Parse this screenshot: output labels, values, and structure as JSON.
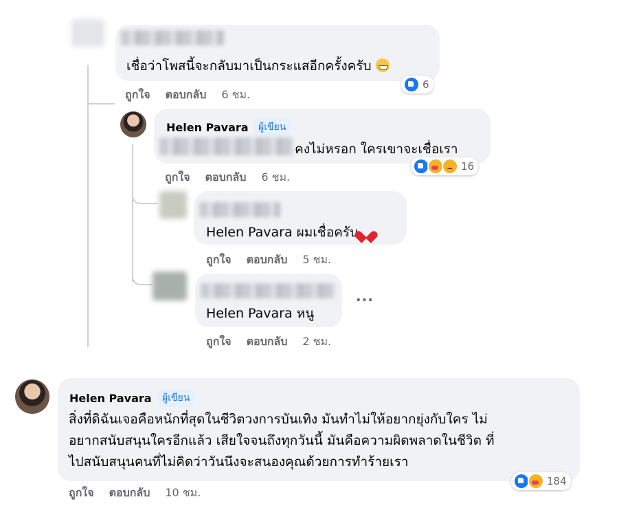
{
  "thread": {
    "c1": {
      "text": "เชื่อว่าโพสนี้จะกลับมาเป็นกระแสอีกครั้งครับ",
      "reactions": {
        "icons": [
          "like-icon"
        ],
        "count": "6"
      },
      "actions": {
        "like": "ถูกใจ",
        "reply": "ตอบกลับ",
        "time": "6 ชม."
      }
    },
    "r1": {
      "author": "Helen Pavara",
      "badge": "ผู้เขียน",
      "text": "คงไม่หรอก ใครเขาจะเชื่อเรา",
      "reactions": {
        "icons": [
          "like-icon",
          "care-icon",
          "sad-icon"
        ],
        "count": "16"
      },
      "actions": {
        "like": "ถูกใจ",
        "reply": "ตอบกลับ",
        "time": "6 ชม."
      }
    },
    "r2": {
      "text": "Helen Pavara ผมเชื่อครับ",
      "actions": {
        "like": "ถูกใจ",
        "reply": "ตอบกลับ",
        "time": "5 ชม."
      }
    },
    "r3": {
      "text": "Helen Pavara หนู",
      "more": "···",
      "actions": {
        "like": "ถูกใจ",
        "reply": "ตอบกลับ",
        "time": "2 ชม."
      }
    }
  },
  "c2": {
    "author": "Helen Pavara",
    "badge": "ผู้เขียน",
    "text": "สิ่งที่ดิฉันเจอคือหนักที่สุดในชีวิตวงการบันเทิง มันทำไม่ให้อยากยุ่งกับใคร ไม่\nอยากสนับสนุนใครอีกแล้ว เสียใจจนถึงทุกวันนี้ มันคือความผิดพลาดในชีวิต ที่\nไปสนับสนุนคนที่ไม่คิดว่าวันนึงจะสนองคุณด้วยการทำร้ายเรา",
    "reactions": {
      "icons": [
        "like-icon",
        "care-icon"
      ],
      "count": "184"
    },
    "actions": {
      "like": "ถูกใจ",
      "reply": "ตอบกลับ",
      "time": "10 ชม."
    }
  },
  "colors": {
    "bubble": "#f0f2f5",
    "secondary_text": "#65676b",
    "badge_bg": "#e7f0fd",
    "badge_text": "#1b74e4",
    "like_blue": "#1877f2"
  }
}
